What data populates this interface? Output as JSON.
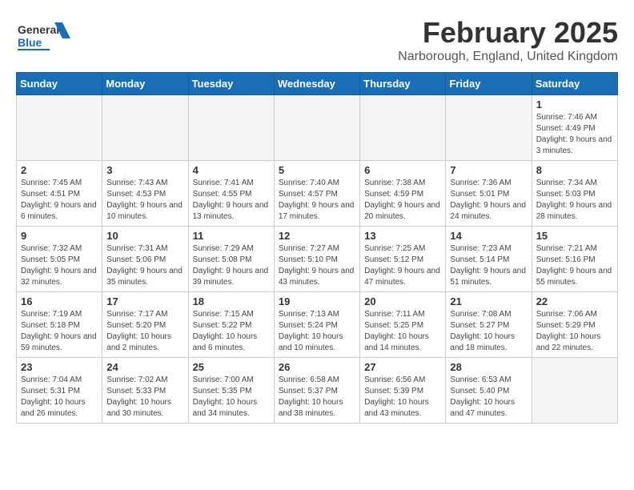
{
  "header": {
    "logo_general": "General",
    "logo_blue": "Blue",
    "title": "February 2025",
    "subtitle": "Narborough, England, United Kingdom"
  },
  "calendar": {
    "days_of_week": [
      "Sunday",
      "Monday",
      "Tuesday",
      "Wednesday",
      "Thursday",
      "Friday",
      "Saturday"
    ],
    "weeks": [
      [
        {
          "day": "",
          "info": ""
        },
        {
          "day": "",
          "info": ""
        },
        {
          "day": "",
          "info": ""
        },
        {
          "day": "",
          "info": ""
        },
        {
          "day": "",
          "info": ""
        },
        {
          "day": "",
          "info": ""
        },
        {
          "day": "1",
          "info": "Sunrise: 7:46 AM\nSunset: 4:49 PM\nDaylight: 9 hours and 3 minutes."
        }
      ],
      [
        {
          "day": "2",
          "info": "Sunrise: 7:45 AM\nSunset: 4:51 PM\nDaylight: 9 hours and 6 minutes."
        },
        {
          "day": "3",
          "info": "Sunrise: 7:43 AM\nSunset: 4:53 PM\nDaylight: 9 hours and 10 minutes."
        },
        {
          "day": "4",
          "info": "Sunrise: 7:41 AM\nSunset: 4:55 PM\nDaylight: 9 hours and 13 minutes."
        },
        {
          "day": "5",
          "info": "Sunrise: 7:40 AM\nSunset: 4:57 PM\nDaylight: 9 hours and 17 minutes."
        },
        {
          "day": "6",
          "info": "Sunrise: 7:38 AM\nSunset: 4:59 PM\nDaylight: 9 hours and 20 minutes."
        },
        {
          "day": "7",
          "info": "Sunrise: 7:36 AM\nSunset: 5:01 PM\nDaylight: 9 hours and 24 minutes."
        },
        {
          "day": "8",
          "info": "Sunrise: 7:34 AM\nSunset: 5:03 PM\nDaylight: 9 hours and 28 minutes."
        }
      ],
      [
        {
          "day": "9",
          "info": "Sunrise: 7:32 AM\nSunset: 5:05 PM\nDaylight: 9 hours and 32 minutes."
        },
        {
          "day": "10",
          "info": "Sunrise: 7:31 AM\nSunset: 5:06 PM\nDaylight: 9 hours and 35 minutes."
        },
        {
          "day": "11",
          "info": "Sunrise: 7:29 AM\nSunset: 5:08 PM\nDaylight: 9 hours and 39 minutes."
        },
        {
          "day": "12",
          "info": "Sunrise: 7:27 AM\nSunset: 5:10 PM\nDaylight: 9 hours and 43 minutes."
        },
        {
          "day": "13",
          "info": "Sunrise: 7:25 AM\nSunset: 5:12 PM\nDaylight: 9 hours and 47 minutes."
        },
        {
          "day": "14",
          "info": "Sunrise: 7:23 AM\nSunset: 5:14 PM\nDaylight: 9 hours and 51 minutes."
        },
        {
          "day": "15",
          "info": "Sunrise: 7:21 AM\nSunset: 5:16 PM\nDaylight: 9 hours and 55 minutes."
        }
      ],
      [
        {
          "day": "16",
          "info": "Sunrise: 7:19 AM\nSunset: 5:18 PM\nDaylight: 9 hours and 59 minutes."
        },
        {
          "day": "17",
          "info": "Sunrise: 7:17 AM\nSunset: 5:20 PM\nDaylight: 10 hours and 2 minutes."
        },
        {
          "day": "18",
          "info": "Sunrise: 7:15 AM\nSunset: 5:22 PM\nDaylight: 10 hours and 6 minutes."
        },
        {
          "day": "19",
          "info": "Sunrise: 7:13 AM\nSunset: 5:24 PM\nDaylight: 10 hours and 10 minutes."
        },
        {
          "day": "20",
          "info": "Sunrise: 7:11 AM\nSunset: 5:25 PM\nDaylight: 10 hours and 14 minutes."
        },
        {
          "day": "21",
          "info": "Sunrise: 7:08 AM\nSunset: 5:27 PM\nDaylight: 10 hours and 18 minutes."
        },
        {
          "day": "22",
          "info": "Sunrise: 7:06 AM\nSunset: 5:29 PM\nDaylight: 10 hours and 22 minutes."
        }
      ],
      [
        {
          "day": "23",
          "info": "Sunrise: 7:04 AM\nSunset: 5:31 PM\nDaylight: 10 hours and 26 minutes."
        },
        {
          "day": "24",
          "info": "Sunrise: 7:02 AM\nSunset: 5:33 PM\nDaylight: 10 hours and 30 minutes."
        },
        {
          "day": "25",
          "info": "Sunrise: 7:00 AM\nSunset: 5:35 PM\nDaylight: 10 hours and 34 minutes."
        },
        {
          "day": "26",
          "info": "Sunrise: 6:58 AM\nSunset: 5:37 PM\nDaylight: 10 hours and 38 minutes."
        },
        {
          "day": "27",
          "info": "Sunrise: 6:56 AM\nSunset: 5:39 PM\nDaylight: 10 hours and 43 minutes."
        },
        {
          "day": "28",
          "info": "Sunrise: 6:53 AM\nSunset: 5:40 PM\nDaylight: 10 hours and 47 minutes."
        },
        {
          "day": "",
          "info": ""
        }
      ]
    ]
  }
}
